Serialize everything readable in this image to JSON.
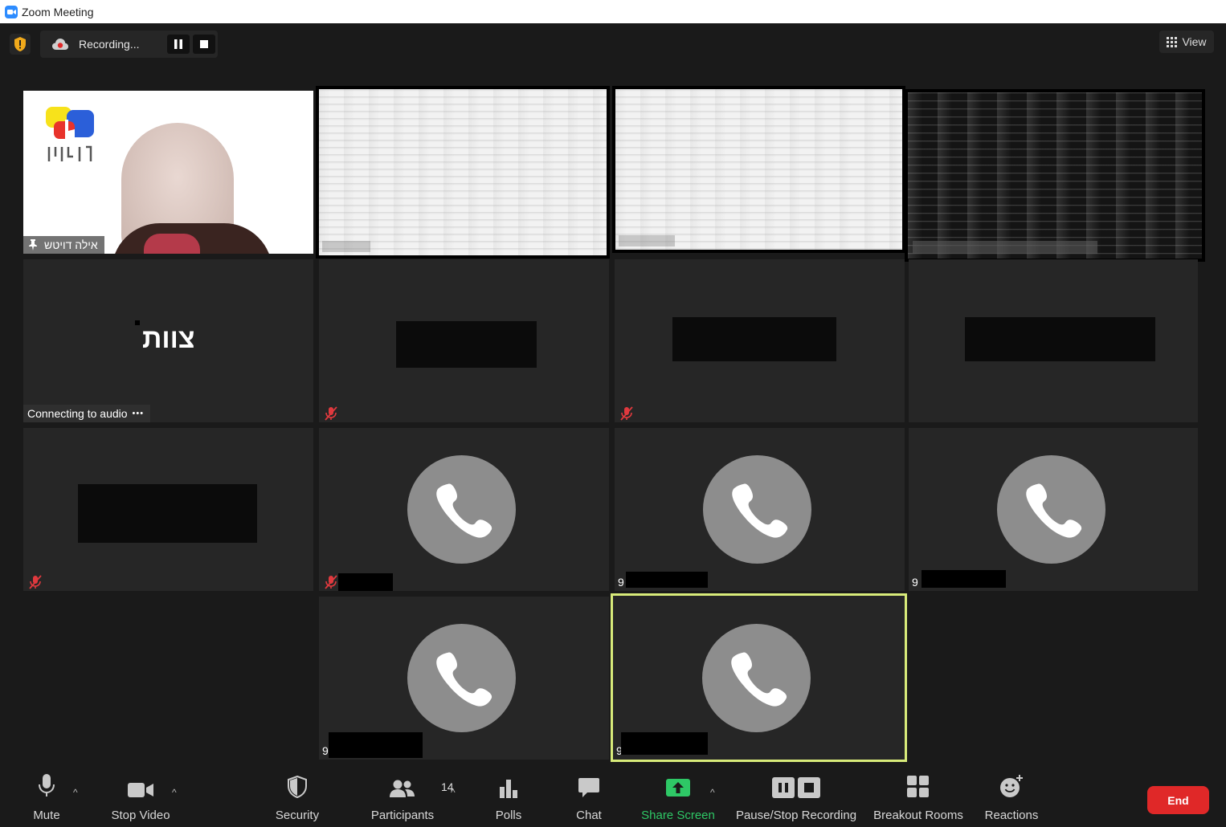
{
  "window": {
    "title": "Zoom Meeting"
  },
  "recording": {
    "label": "Recording..."
  },
  "view": {
    "label": "View"
  },
  "tiles": [
    {
      "name": "אילה דויטש"
    },
    {
      "name": ""
    },
    {
      "name": ""
    },
    {
      "name": ""
    },
    {
      "big_name": "צוות",
      "status": "Connecting to audio"
    },
    {
      "name": ""
    },
    {
      "name": ""
    },
    {
      "name": ""
    },
    {
      "name": ""
    },
    {
      "name": ""
    },
    {
      "name": "9"
    },
    {
      "name": "9"
    },
    {
      "name": "9"
    },
    {
      "name": "9"
    }
  ],
  "toolbar": {
    "mute": "Mute",
    "stop_video": "Stop Video",
    "security": "Security",
    "participants": "Participants",
    "participants_count": "14",
    "polls": "Polls",
    "chat": "Chat",
    "share_screen": "Share Screen",
    "recording": "Pause/Stop Recording",
    "breakout": "Breakout Rooms",
    "reactions": "Reactions",
    "end": "End"
  },
  "colors": {
    "share_green": "#2ec866",
    "end_red": "#e02828",
    "active_speaker": "#d8eb7a"
  }
}
